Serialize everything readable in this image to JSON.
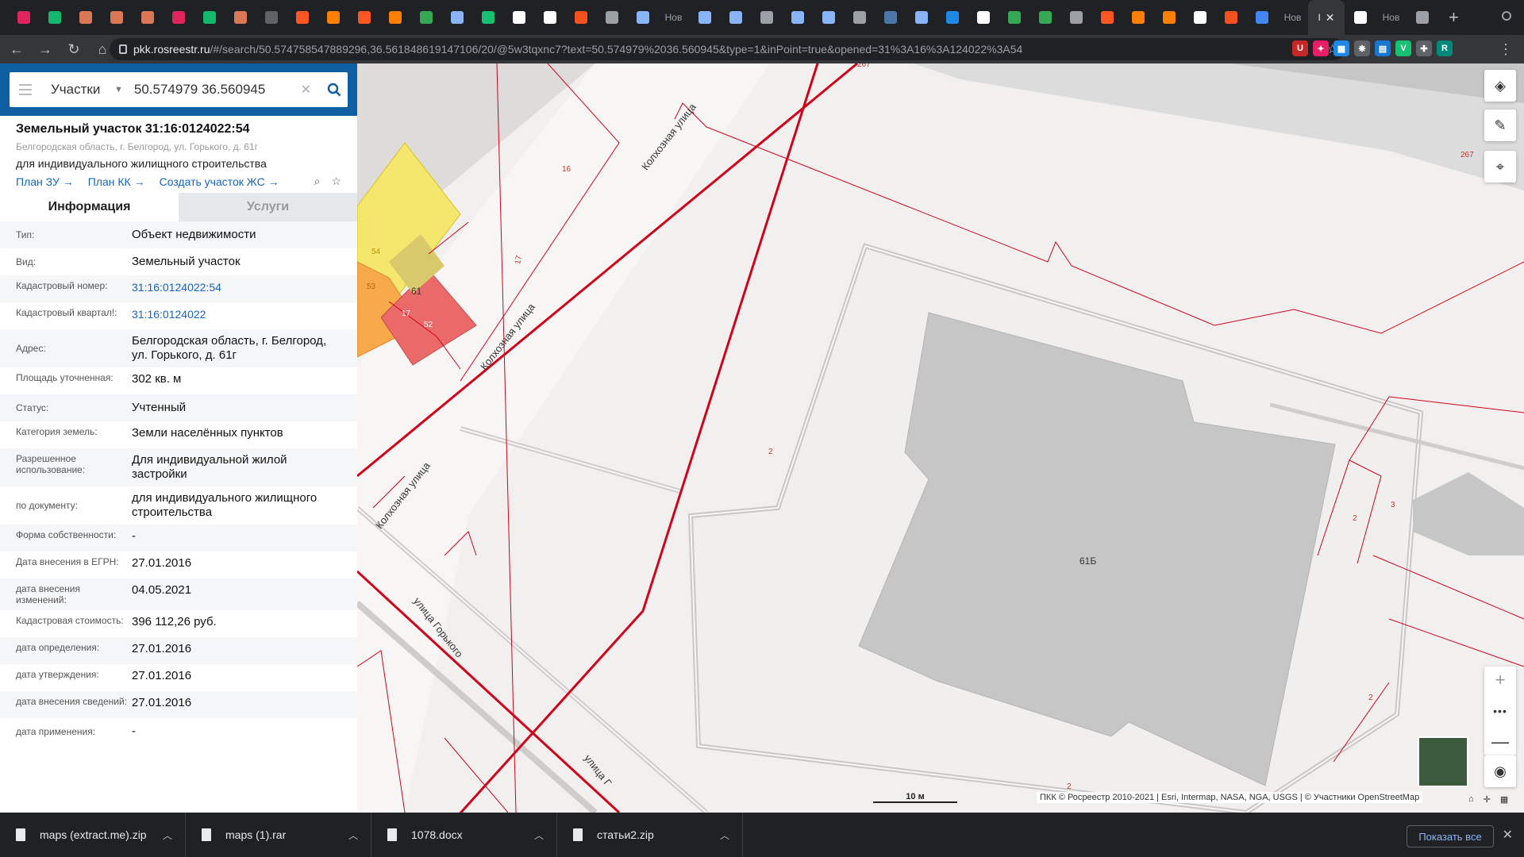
{
  "browser": {
    "tabs": [
      {
        "icon": "red-app-icon",
        "color": "#e0245e",
        "title": ""
      },
      {
        "icon": "green-app-icon",
        "color": "#14b86a",
        "title": ""
      },
      {
        "icon": "warning-icon",
        "color": "#d97757",
        "title": ""
      },
      {
        "icon": "warning-icon",
        "color": "#d97757",
        "title": ""
      },
      {
        "icon": "warning-icon",
        "color": "#d97757",
        "title": ""
      },
      {
        "icon": "red-app-icon",
        "color": "#e0245e",
        "title": ""
      },
      {
        "icon": "green-app-icon",
        "color": "#14b86a",
        "title": ""
      },
      {
        "icon": "warning-icon",
        "color": "#d97757",
        "title": ""
      },
      {
        "icon": "globe-icon",
        "color": "#5f6368",
        "title": ""
      },
      {
        "icon": "ring-icon",
        "color": "#ff5722",
        "title": ""
      },
      {
        "icon": "book-icon",
        "color": "#ff7f00",
        "title": ""
      },
      {
        "icon": "ring-icon",
        "color": "#ff5722",
        "title": ""
      },
      {
        "icon": "book-icon",
        "color": "#ff7f00",
        "title": ""
      },
      {
        "icon": "drive-icon",
        "color": "#34a853",
        "title": ""
      },
      {
        "icon": "moon-icon",
        "color": "#8ab4f8",
        "title": ""
      },
      {
        "icon": "v-icon",
        "color": "#16c172",
        "title": ""
      },
      {
        "icon": "circle-icon",
        "color": "#ffffff",
        "title": ""
      },
      {
        "icon": "square-icon",
        "color": "#ffffff",
        "title": ""
      },
      {
        "icon": "orange-app-icon",
        "color": "#f4511e",
        "title": ""
      },
      {
        "icon": "wordpress-icon",
        "color": "#9aa0a6",
        "title": ""
      },
      {
        "icon": "moon-icon",
        "color": "#8ab4f8",
        "title": ""
      },
      {
        "icon": "",
        "color": "",
        "title": "Нов"
      },
      {
        "icon": "moon-icon",
        "color": "#8ab4f8",
        "title": ""
      },
      {
        "icon": "moon-icon",
        "color": "#8ab4f8",
        "title": ""
      },
      {
        "icon": "wordpress-icon",
        "color": "#9aa0a6",
        "title": ""
      },
      {
        "icon": "moon-icon",
        "color": "#8ab4f8",
        "title": ""
      },
      {
        "icon": "moon-icon",
        "color": "#8ab4f8",
        "title": ""
      },
      {
        "icon": "wordpress-icon",
        "color": "#9aa0a6",
        "title": ""
      },
      {
        "icon": "vk-icon",
        "color": "#4a76a8",
        "title": ""
      },
      {
        "icon": "moon-icon",
        "color": "#8ab4f8",
        "title": ""
      },
      {
        "icon": "blue-app-icon",
        "color": "#1e88e5",
        "title": ""
      },
      {
        "icon": "google-icon",
        "color": "#ffffff",
        "title": ""
      },
      {
        "icon": "drive-icon",
        "color": "#34a853",
        "title": ""
      },
      {
        "icon": "drive-icon",
        "color": "#34a853",
        "title": ""
      },
      {
        "icon": "table-icon",
        "color": "#9aa0a6",
        "title": ""
      },
      {
        "icon": "ring-icon",
        "color": "#ff5722",
        "title": ""
      },
      {
        "icon": "book-icon",
        "color": "#ff7f00",
        "title": ""
      },
      {
        "icon": "book-icon",
        "color": "#ff7f00",
        "title": ""
      },
      {
        "icon": "google-icon",
        "color": "#ffffff",
        "title": ""
      },
      {
        "icon": "chart-icon",
        "color": "#f4511e",
        "title": ""
      },
      {
        "icon": "dots-app-icon",
        "color": "#4285f4",
        "title": ""
      },
      {
        "icon": "",
        "color": "",
        "title": "Нов"
      }
    ],
    "active_tab": {
      "title": "I",
      "close": "✕"
    },
    "trailing_tabs": [
      {
        "icon": "google-icon",
        "color": "#ffffff",
        "title": ""
      },
      {
        "icon": "",
        "color": "",
        "title": "Нов"
      },
      {
        "icon": "apple-icon",
        "color": "#9aa0a6",
        "title": ""
      }
    ],
    "new_tab": "+",
    "url_host": "pkk.rosreestr.ru",
    "url_path": "/#/search/50.574758547889296,36.561848619147106/20/@5w3tqxnc7?text=50.574979%2036.560945&type=1&inPoint=true&opened=31%3A16%3A124022%3A54",
    "extensions": [
      {
        "label": "U",
        "color": "#c62828"
      },
      {
        "label": "✦",
        "color": "#e91e63"
      },
      {
        "label": "▦",
        "color": "#1e88e5"
      },
      {
        "label": "❋",
        "color": "#5f6368"
      },
      {
        "label": "▤",
        "color": "#1976d2"
      },
      {
        "label": "V",
        "color": "#16c172"
      },
      {
        "label": "✚",
        "color": "#5f6368"
      },
      {
        "label": "R",
        "color": "#00897b"
      }
    ]
  },
  "panel": {
    "search": {
      "category": "Участки",
      "value": "50.574979 36.560945"
    },
    "object": {
      "title": "Земельный участок 31:16:0124022:54",
      "address": "Белгородская область, г. Белгород, ул. Горького, д. 61г",
      "use": "для индивидуального жилищного строительства",
      "links": [
        "План ЗУ →",
        "План КК →",
        "Создать участок ЖС →"
      ]
    },
    "tabs": [
      "Информация",
      "Услуги"
    ],
    "rows": [
      {
        "k": "Тип:",
        "v": "Объект недвижимости",
        "link": false
      },
      {
        "k": "Вид:",
        "v": "Земельный участок",
        "link": false
      },
      {
        "k": "Кадастровый номер:",
        "v": "31:16:0124022:54",
        "link": true
      },
      {
        "k": "Кадастровый квартал!:",
        "v": "31:16:0124022",
        "link": true
      },
      {
        "k": "Адрес:",
        "v": "Белгородская область, г. Белгород, ул. Горького, д. 61г",
        "link": false
      },
      {
        "k": "Площадь уточненная:",
        "v": "302 кв. м",
        "link": false
      },
      {
        "k": "Статус:",
        "v": "Учтенный",
        "link": false
      },
      {
        "k": "Категория земель:",
        "v": "Земли населённых пунктов",
        "link": false
      },
      {
        "k": "Разрешенное использование:",
        "v": "Для индивидуальной жилой застройки",
        "link": false
      },
      {
        "k": "по документу:",
        "v": "для индивидуального жилищного строительства",
        "link": false
      },
      {
        "k": "Форма собственности:",
        "v": "-",
        "link": false
      },
      {
        "k": "Дата внесения в ЕГРН:",
        "v": "27.01.2016",
        "link": false
      },
      {
        "k": "дата внесения изменений:",
        "v": "04.05.2021",
        "link": false
      },
      {
        "k": "Кадастровая стоимость:",
        "v": "396 112,26 руб.",
        "link": false
      },
      {
        "k": "дата определения:",
        "v": "27.01.2016",
        "link": false
      },
      {
        "k": "дата утверждения:",
        "v": "27.01.2016",
        "link": false
      },
      {
        "k": "дата внесения сведений:",
        "v": "27.01.2016",
        "link": false
      },
      {
        "k": "дата применения:",
        "v": "-",
        "link": false
      }
    ]
  },
  "map": {
    "street_labels": [
      "Колхозная улица",
      "Колхозная улица",
      "Колхозная улица",
      "улица Горького",
      "улица Г"
    ],
    "parcel_numbers": [
      "16",
      "17",
      "54",
      "53",
      "17",
      "52",
      "2",
      "2",
      "2",
      "2",
      "3",
      "267",
      "267"
    ],
    "building_numbers": [
      "61",
      "61Б"
    ],
    "scale": "10 м",
    "attribution": "ПКК © Росреестр 2010-2021 | Esri, Intermap, NASA, NGA, USGS | © Участники OpenStreetMap",
    "zoom_in": "+",
    "zoom_out": "—",
    "zoom_more": "•••"
  },
  "downloads": {
    "items": [
      "maps (extract.me).zip",
      "maps (1).rar",
      "1078.docx",
      "статьи2.zip"
    ],
    "show_all": "Показать все",
    "close": "✕"
  },
  "colors": {
    "accent": "#0d5fa2",
    "link": "#1565c0",
    "parcel_line": "#d0021b",
    "selected_parcel": "#f5e66e",
    "orange_parcel": "#f7a94b",
    "red_parcel": "#ea6a6a",
    "building": "#c6c6c6"
  }
}
